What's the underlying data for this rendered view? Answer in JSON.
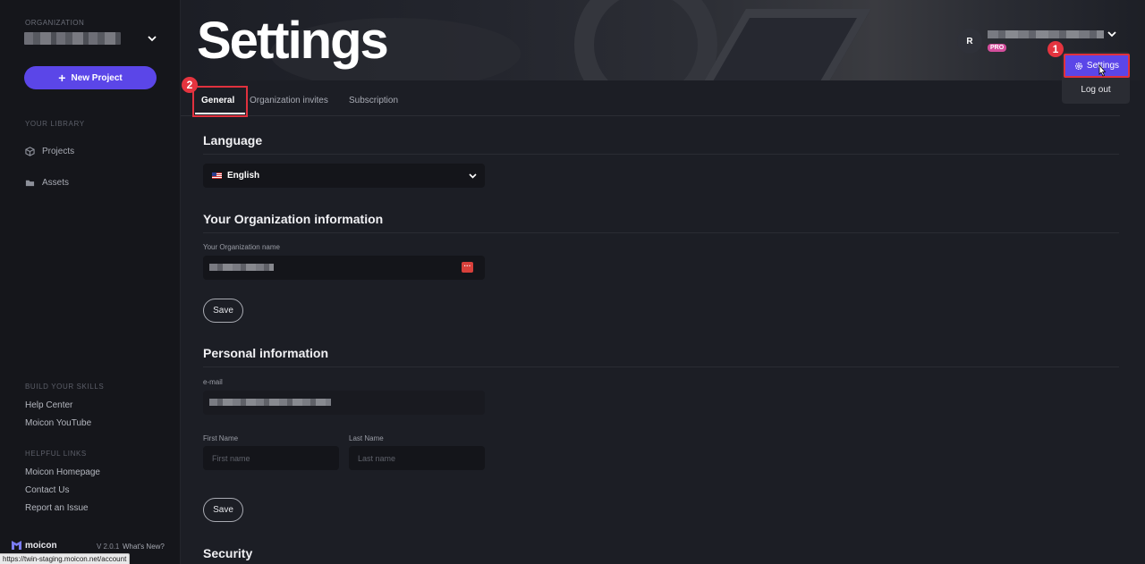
{
  "sidebar": {
    "org_label": "ORGANIZATION",
    "new_project_label": "New Project",
    "library_label": "YOUR LIBRARY",
    "nav": [
      {
        "label": "Projects",
        "icon": "cube-icon"
      },
      {
        "label": "Assets",
        "icon": "folder-icon"
      }
    ],
    "skills_label": "BUILD YOUR SKILLS",
    "skills_links": [
      "Help Center",
      "Moicon YouTube"
    ],
    "helpful_label": "HELPFUL LINKS",
    "helpful_links": [
      "Moicon Homepage",
      "Contact Us",
      "Report an Issue"
    ],
    "logo_text": "moicon",
    "version": "V 2.0.1",
    "whats_new": "What's New?"
  },
  "status_url": "https://twin-staging.moicon.net/account",
  "header": {
    "title": "Settings",
    "avatar_initial": "R",
    "pro_badge": "PRO"
  },
  "user_menu": {
    "settings_label": "Settings",
    "logout_label": "Log out"
  },
  "annotations": {
    "step1": "1",
    "step2": "2",
    "highlight_color": "#e0313e"
  },
  "tabs": [
    "General",
    "Organization invites",
    "Subscription"
  ],
  "active_tab": "General",
  "language": {
    "section_title": "Language",
    "selected": "English"
  },
  "organization": {
    "section_title": "Your Organization information",
    "name_label": "Your Organization name",
    "save_label": "Save"
  },
  "personal": {
    "section_title": "Personal information",
    "email_label": "e-mail",
    "first_name_label": "First Name",
    "first_name_placeholder": "First name",
    "last_name_label": "Last Name",
    "last_name_placeholder": "Last name",
    "save_label": "Save"
  },
  "security": {
    "section_title": "Security"
  },
  "colors": {
    "accent": "#5b46e8",
    "pro": "#d34e9c",
    "background": "#1c1e25",
    "sidebar": "#15161b"
  }
}
